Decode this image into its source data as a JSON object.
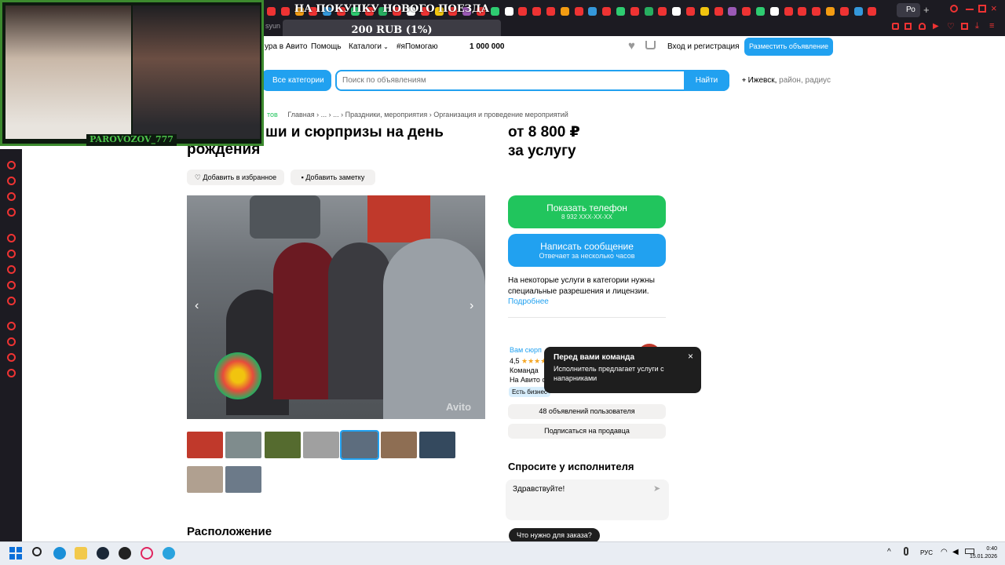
{
  "browser": {
    "overlay_title": "НА ПОКУПКУ НОВОГО ПОЕЗДА",
    "overlay_amount": "200 RUB (1%)",
    "tab_active_label": "Ро",
    "address_fragment": "syun"
  },
  "stream": {
    "username": "PAROVOZOV_777"
  },
  "avito_nav": {
    "link_partial": "ура в Авито",
    "help": "Помощь",
    "catalogs": "Каталоги",
    "helping": "#яПомогаю",
    "counter": "1 000 000",
    "login": "Вход и регистрация",
    "post_ad": "Разместить объявление"
  },
  "search": {
    "all_categories": "Все категории",
    "placeholder": "Поиск по объявлениям",
    "find": "Найти",
    "city": "Ижевск,",
    "location_hint": "район, радиус"
  },
  "breadcrumb": {
    "partial": "тов",
    "home": "Главная",
    "sep1": "...",
    "sep2": "...",
    "cat1": "Праздники, мероприятия",
    "cat2": "Организация и проведение мероприятий"
  },
  "listing": {
    "title_line1": "ши и сюрпризы на день",
    "title_line2": "рождения",
    "add_favorite": "Добавить в избранное",
    "add_note": "Добавить заметку",
    "price_line1": "от 8 800 ₽",
    "price_line2": "за услугу",
    "show_phone": "Показать телефон",
    "phone_masked": "8 932 XXX-XX-XX",
    "write_message": "Написать сообщение",
    "reply_time": "Отвечает за несколько часов",
    "license_note": "На некоторые услуги в категории нужны специальные разрешения и лицензии.",
    "more": "Подробнее",
    "watermark": "Avito"
  },
  "seller": {
    "name_partial": "Вам сюрп",
    "rating": "4,5",
    "stars": "★★★★",
    "type_partial": "Команда",
    "since_partial": "На Авито с",
    "badge": "Есть бизнес",
    "listings": "48 объявлений пользователя",
    "subscribe": "Подписаться на продавца"
  },
  "tooltip": {
    "title": "Перед вами команда",
    "text": "Исполнитель предлагает услуги с напарниками",
    "close": "×"
  },
  "ask": {
    "heading": "Спросите у исполнителя",
    "message": "Здравствуйте!",
    "chip": "Что нужно для заказа?"
  },
  "location": {
    "heading": "Расположение"
  },
  "taskbar": {
    "lang": "РУС",
    "time": "0:40",
    "date": "15.01.2026"
  },
  "colors": {
    "green": "#21c55d",
    "blue": "#21a1f0",
    "dark_chrome": "#1c1b22"
  }
}
